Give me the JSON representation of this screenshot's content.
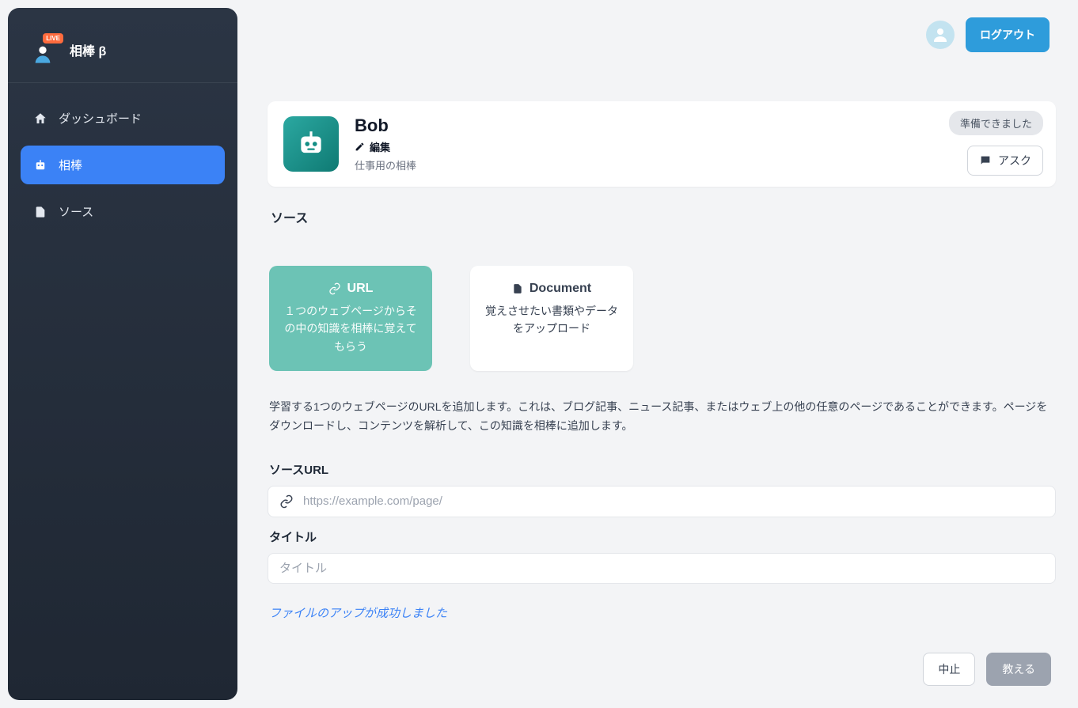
{
  "brand": "相棒 β",
  "live_badge": "LIVE",
  "sidebar": {
    "items": [
      {
        "label": "ダッシュボード"
      },
      {
        "label": "相棒"
      },
      {
        "label": "ソース"
      }
    ]
  },
  "topbar": {
    "logout_label": "ログアウト"
  },
  "bot": {
    "name": "Bob",
    "edit_label": "編集",
    "description": "仕事用の相棒",
    "status": "準備できました",
    "ask_label": "アスク"
  },
  "sources": {
    "title": "ソース",
    "options": {
      "url": {
        "title": "URL",
        "desc": "１つのウェブページからその中の知識を相棒に覚えてもらう"
      },
      "document": {
        "title": "Document",
        "desc": "覚えさせたい書類やデータをアップロード"
      }
    },
    "help_text": "学習する1つのウェブページのURLを追加します。これは、ブログ記事、ニュース記事、またはウェブ上の他の任意のページであることができます。ページをダウンロードし、コンテンツを解析して、この知識を相棒に追加します。",
    "url_field": {
      "label": "ソースURL",
      "placeholder": "https://example.com/page/"
    },
    "title_field": {
      "label": "タイトル",
      "placeholder": "タイトル"
    },
    "upload_success": "ファイルのアップが成功しました"
  },
  "actions": {
    "cancel": "中止",
    "teach": "教える"
  }
}
